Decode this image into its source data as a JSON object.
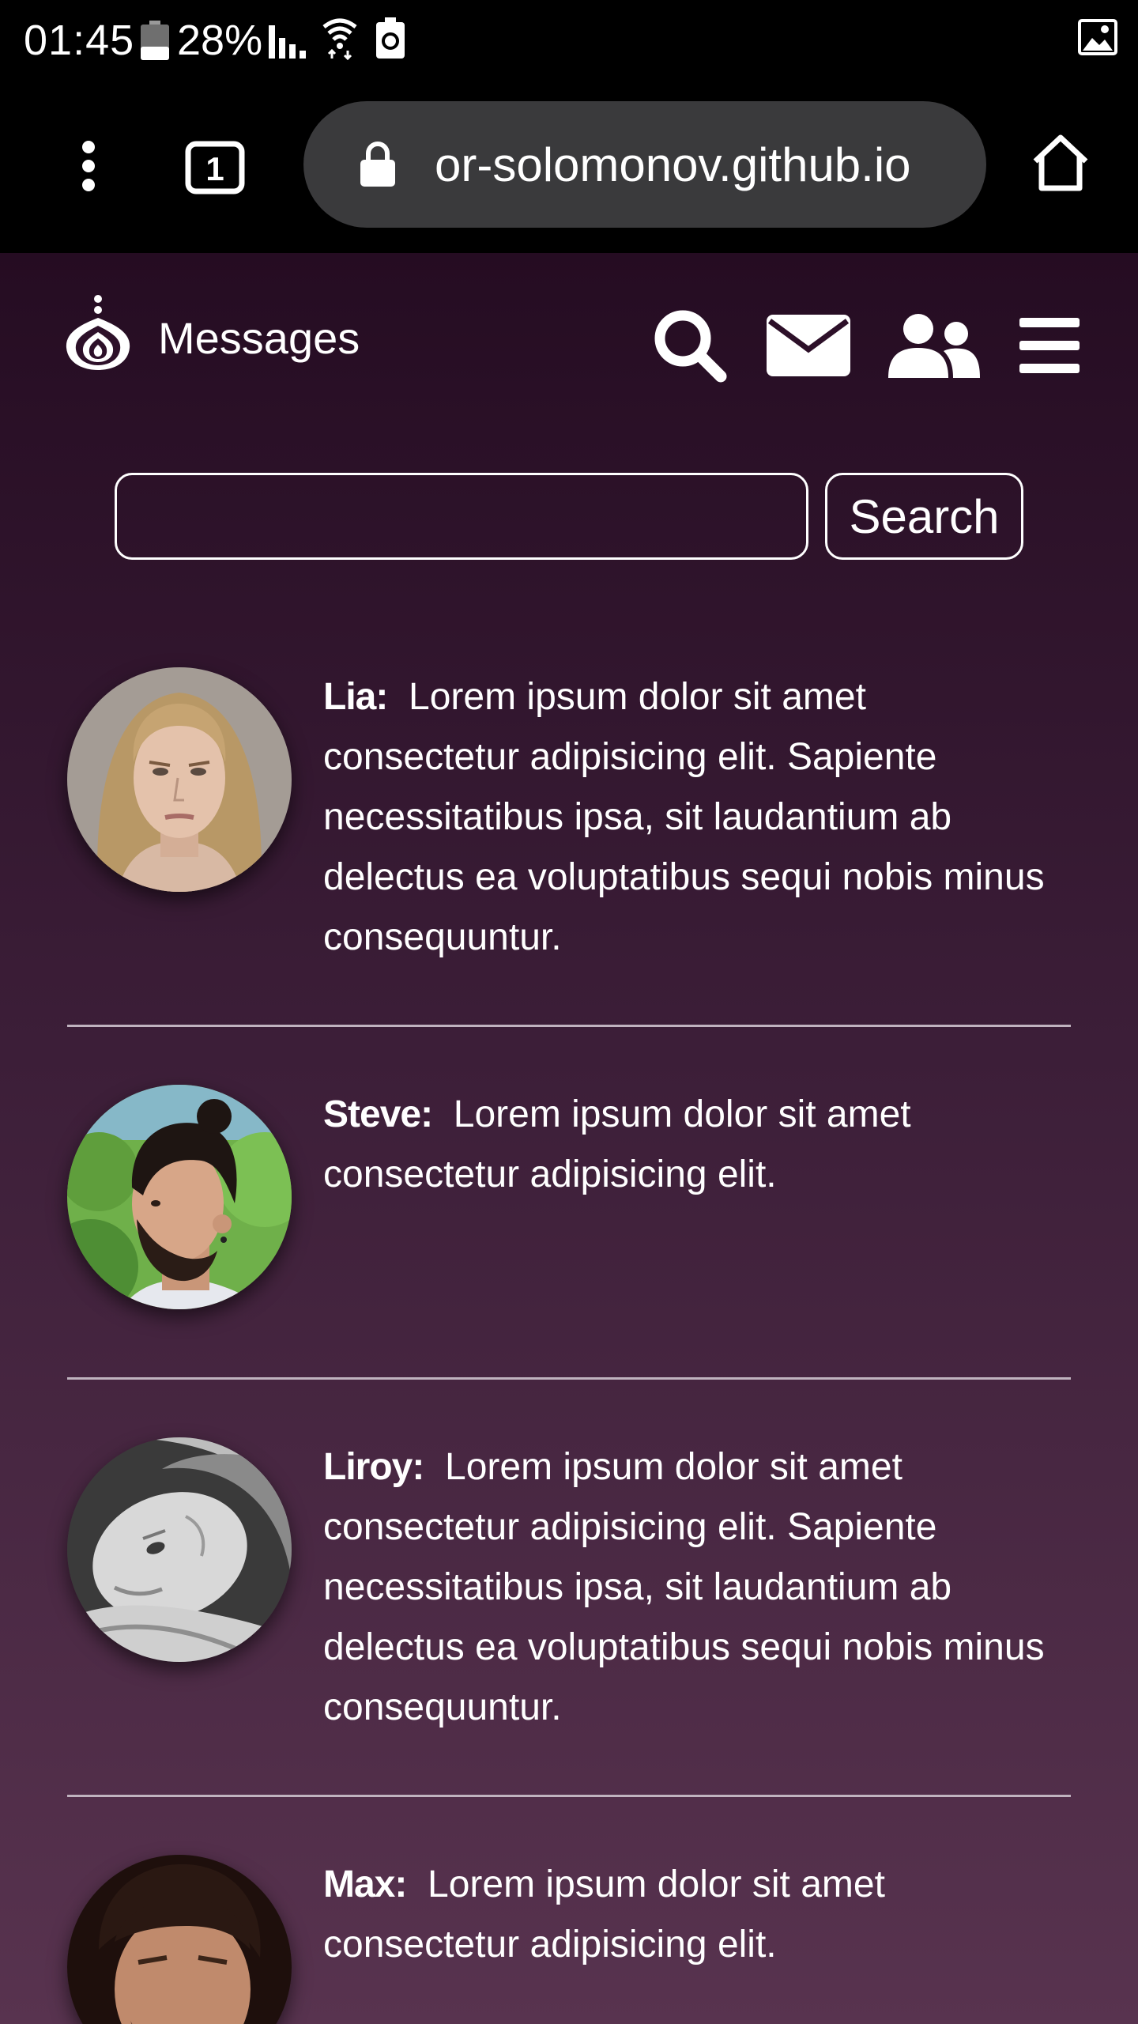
{
  "status_bar": {
    "time": "01:45",
    "battery": "28%",
    "icons": [
      "battery-icon",
      "signal-icon",
      "wifi-icon",
      "battery-saver-icon",
      "image-icon"
    ]
  },
  "browser": {
    "url": "or-solomonov.github.io",
    "tab_count": "1",
    "icons": [
      "menu-dots-icon",
      "tabs-icon",
      "lock-icon",
      "home-icon"
    ]
  },
  "nav": {
    "title": "Messages",
    "icons": [
      "logo-icon",
      "search-icon",
      "mail-icon",
      "people-icon",
      "hamburger-menu-icon"
    ]
  },
  "search": {
    "value": "",
    "placeholder": "",
    "button_label": "Search"
  },
  "messages": [
    {
      "name": "Lia:",
      "text": "Lorem ipsum dolor sit amet consectetur adipisicing elit. Sapiente necessitatibus ipsa, sit laudantium ab delectus ea voluptatibus sequi nobis minus consequuntur."
    },
    {
      "name": "Steve:",
      "text": "Lorem ipsum dolor sit amet consectetur adipisicing elit."
    },
    {
      "name": "Liroy:",
      "text": "Lorem ipsum dolor sit amet consectetur adipisicing elit. Sapiente necessitatibus ipsa, sit laudantium ab delectus ea voluptatibus sequi nobis minus consequuntur."
    },
    {
      "name": "Max:",
      "text": "Lorem ipsum dolor sit amet consectetur adipisicing elit."
    }
  ],
  "colors": {
    "page_top": "#250c22",
    "page_bottom": "#58334f",
    "divider": "#c0b3bf",
    "text": "#ffffff",
    "address_bar": "#3a3a3c"
  }
}
